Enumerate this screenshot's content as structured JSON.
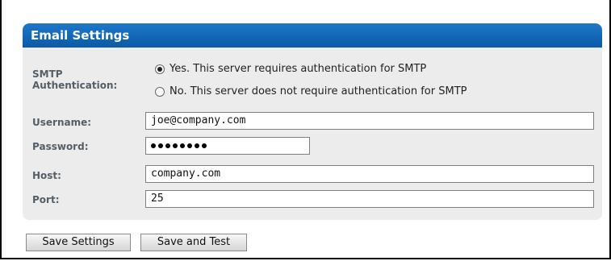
{
  "panel": {
    "title": "Email Settings"
  },
  "form": {
    "smtp_label_line1": "SMTP",
    "smtp_label_line2": "Authentication:",
    "smtp_options": [
      {
        "label": "Yes. This server requires authentication for SMTP",
        "selected": true
      },
      {
        "label": "No. This server does not require authentication for SMTP",
        "selected": false
      }
    ],
    "username_label": "Username:",
    "username_value": "joe@company.com",
    "password_label": "Password:",
    "password_masked_length": 8,
    "host_label": "Host:",
    "host_value": "company.com",
    "port_label": "Port:",
    "port_value": "25"
  },
  "buttons": {
    "save_settings": "Save Settings",
    "save_and_test": "Save and Test"
  },
  "colors": {
    "header_blue": "#0a5aa8",
    "panel_bg": "#ececec",
    "label_gray": "#555e66"
  }
}
